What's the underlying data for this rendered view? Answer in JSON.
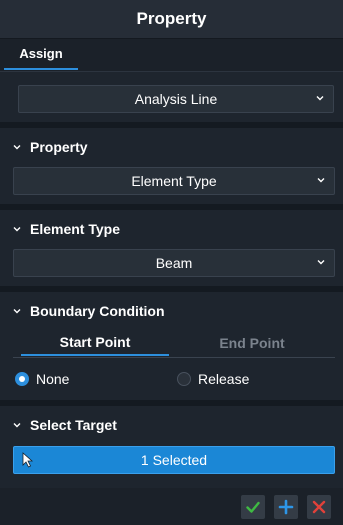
{
  "window": {
    "title": "Property"
  },
  "tabs": [
    {
      "label": "Assign",
      "active": true
    }
  ],
  "assign": {
    "selected": "Analysis Line"
  },
  "property_section": {
    "title": "Property",
    "selected": "Element Type"
  },
  "element_type_section": {
    "title": "Element Type",
    "selected": "Beam"
  },
  "boundary_section": {
    "title": "Boundary Condition",
    "tabs": [
      {
        "label": "Start Point",
        "active": true
      },
      {
        "label": "End Point",
        "active": false
      }
    ],
    "options": [
      {
        "label": "None",
        "checked": true
      },
      {
        "label": "Release",
        "checked": false
      }
    ]
  },
  "select_target_section": {
    "title": "Select Target",
    "button_label": "1 Selected"
  },
  "footer": {
    "icons": [
      "check-icon",
      "plus-icon",
      "close-icon"
    ]
  },
  "colors": {
    "accent": "#2d8fdd",
    "ok": "#3fba43",
    "add": "#2d96e8",
    "cancel": "#e0413a"
  }
}
